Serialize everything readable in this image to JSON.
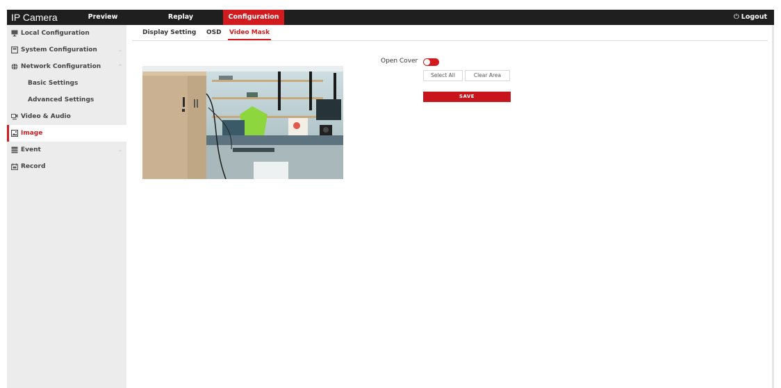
{
  "header": {
    "app_title": "IP Camera",
    "nav": [
      {
        "label": "Preview"
      },
      {
        "label": "Replay"
      },
      {
        "label": "Configuration"
      }
    ],
    "logout_label": "Logout",
    "logout_icon": "power-icon"
  },
  "sidebar": {
    "items": [
      {
        "label": "Local Configuration",
        "icon": "monitor-icon"
      },
      {
        "label": "System Configuration",
        "icon": "system-icon",
        "chevron": "⌄"
      },
      {
        "label": "Network Configuration",
        "icon": "globe-icon",
        "chevron": "^"
      },
      {
        "label": "Basic Settings"
      },
      {
        "label": "Advanced Settings"
      },
      {
        "label": "Video & Audio",
        "icon": "video-audio-icon"
      },
      {
        "label": "Image",
        "icon": "image-icon"
      },
      {
        "label": "Event",
        "icon": "event-icon",
        "chevron": "⌄"
      },
      {
        "label": "Record",
        "icon": "record-icon"
      }
    ]
  },
  "tabs": [
    {
      "label": "Display Setting"
    },
    {
      "label": "OSD"
    },
    {
      "label": "Video Mask"
    }
  ],
  "mask": {
    "open_cover_label": "Open Cover",
    "open_cover_on": true,
    "select_all_label": "Select All",
    "clear_area_label": "Clear Area",
    "save_label": "SAVE"
  },
  "colors": {
    "accent": "#d21b1f",
    "topbar": "#1f1f1f",
    "sidebar": "#ececec"
  }
}
